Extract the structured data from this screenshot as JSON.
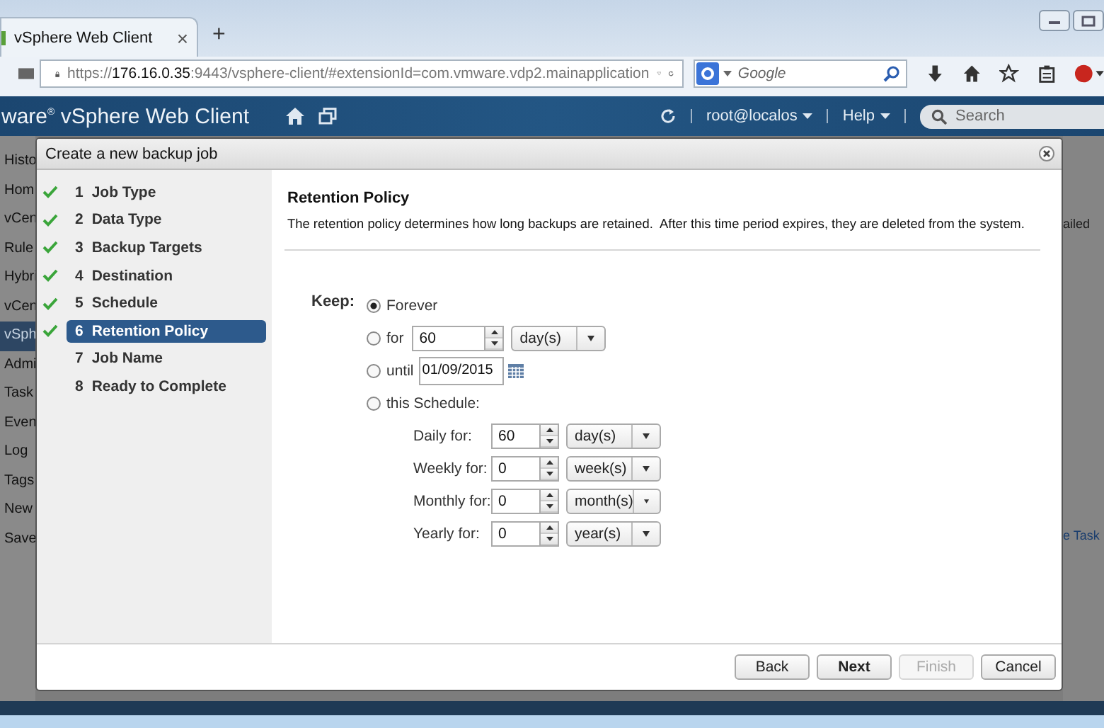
{
  "browser": {
    "tab_title": "vSphere Web Client",
    "tab_close": "×",
    "new_tab": "+",
    "url": "https://**176.16.0.35**:9443/vsphere-client/#extensionId=com.vmware.vdp2.mainapplication",
    "search_placeholder": "Google"
  },
  "app_header": {
    "logo": "ware$^{®}$ vSphere Web Client",
    "user": "root@localos",
    "help": "Help",
    "search_placeholder": "Search"
  },
  "background": {
    "sidebar_items": [
      {
        "label": "Histo",
        "selected": false
      },
      {
        "label": "Hom",
        "selected": false
      },
      {
        "label": "vCen",
        "selected": false
      },
      {
        "label": "Rule",
        "selected": false
      },
      {
        "label": "Hybri",
        "selected": false
      },
      {
        "label": "vCen",
        "selected": false
      },
      {
        "label": "vSph",
        "selected": true
      },
      {
        "label": "Admi",
        "selected": false
      },
      {
        "label": "Task",
        "selected": false
      },
      {
        "label": "Even",
        "selected": false
      },
      {
        "label": "Log",
        "selected": false
      },
      {
        "label": "Tags",
        "selected": false
      },
      {
        "label": "New",
        "selected": false
      },
      {
        "label": "Save",
        "selected": false
      }
    ],
    "right_texts": [
      "ailed",
      "e Task"
    ]
  },
  "dialog": {
    "title": "Create a new backup job",
    "steps": [
      {
        "number": "1",
        "label": "Job Type",
        "done": true,
        "selected": false
      },
      {
        "number": "2",
        "label": "Data Type",
        "done": true,
        "selected": false
      },
      {
        "number": "3",
        "label": "Backup Targets",
        "done": true,
        "selected": false
      },
      {
        "number": "4",
        "label": "Destination",
        "done": true,
        "selected": false
      },
      {
        "number": "5",
        "label": "Schedule",
        "done": true,
        "selected": false
      },
      {
        "number": "6",
        "label": "Retention Policy",
        "done": true,
        "selected": true
      },
      {
        "number": "7",
        "label": "Job Name",
        "done": false,
        "selected": false
      },
      {
        "number": "8",
        "label": "Ready to Complete",
        "done": false,
        "selected": false
      }
    ],
    "heading": "Retention Policy",
    "description": "The retention policy determines how long backups are retained.  After this time period expires, they are deleted from the system.",
    "keep_label": "Keep:",
    "options": [
      {
        "kind": "forever",
        "label": "Forever",
        "selected": true
      },
      {
        "kind": "duration",
        "label": "for",
        "value": "60",
        "unit": "day(s)",
        "selected": false
      },
      {
        "kind": "date",
        "label": "until",
        "value": "01/09/2015",
        "selected": false
      },
      {
        "kind": "schedule",
        "label": "this Schedule:",
        "selected": false,
        "rows": [
          {
            "label": "Daily for:",
            "value": "60",
            "unit": "day(s)"
          },
          {
            "label": "Weekly for:",
            "value": "0",
            "unit": "week(s)"
          },
          {
            "label": "Monthly for:",
            "value": "0",
            "unit": "month(s)"
          },
          {
            "label": "Yearly for:",
            "value": "0",
            "unit": "year(s)"
          }
        ]
      }
    ],
    "buttons": [
      {
        "label": "Back",
        "disabled": false,
        "default": false
      },
      {
        "label": "Next",
        "disabled": false,
        "default": true
      },
      {
        "label": "Finish",
        "disabled": true,
        "default": false
      },
      {
        "label": "Cancel",
        "disabled": false,
        "default": false
      }
    ]
  }
}
